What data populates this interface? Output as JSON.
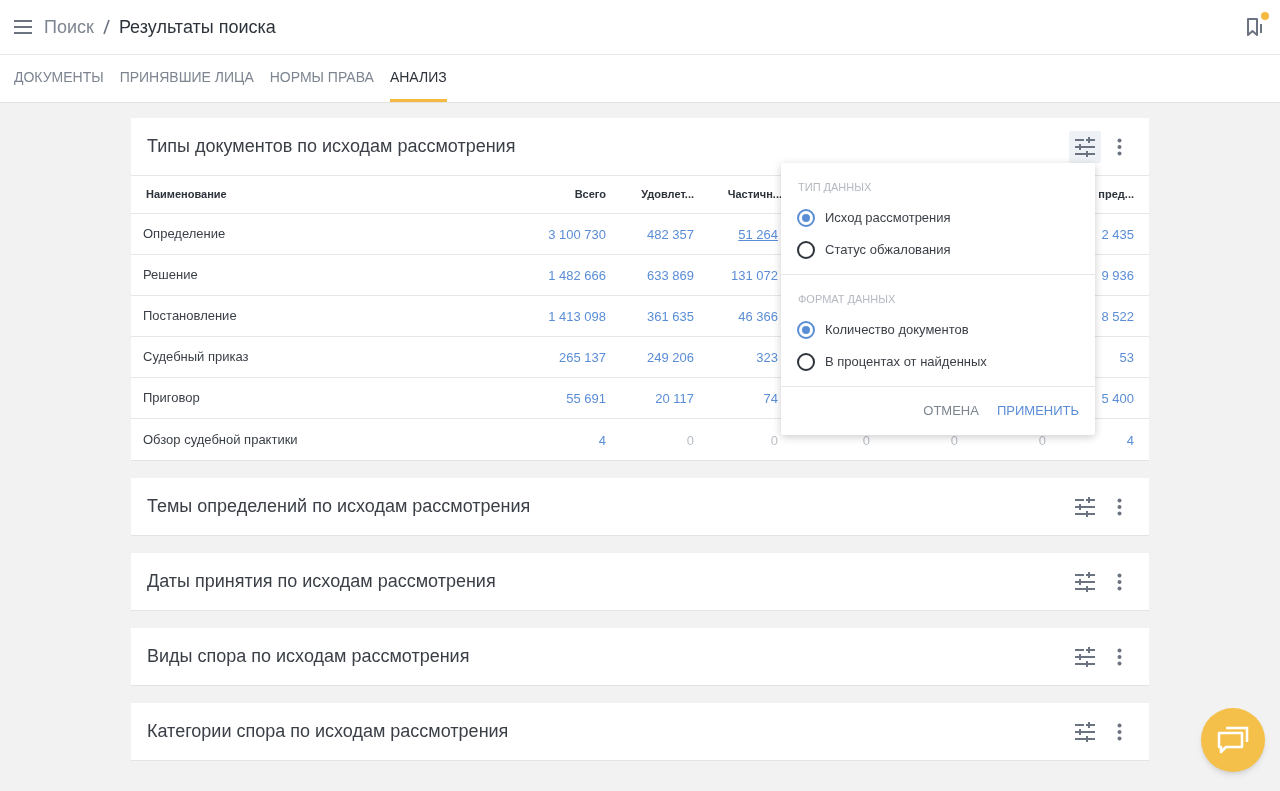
{
  "header": {
    "breadcrumbs": [
      {
        "label": "Поиск",
        "current": false
      },
      {
        "label": "Результаты поиска",
        "current": true
      }
    ],
    "bookmarks_badge": true
  },
  "tabs": [
    {
      "label": "ДОКУМЕНТЫ",
      "selected": false
    },
    {
      "label": "ПРИНЯВШИЕ ЛИЦА",
      "selected": false
    },
    {
      "label": "НОРМЫ ПРАВА",
      "selected": false
    },
    {
      "label": "АНАЛИЗ",
      "selected": true
    }
  ],
  "panels": [
    {
      "title": "Типы документов по исходам рассмотрения",
      "settings_open": true,
      "table": {
        "columns": [
          "Наименование",
          "Всего",
          "Удовлет...",
          "Частичн...",
          null,
          null,
          null,
          "пред..."
        ],
        "rows": [
          {
            "cells": [
              {
                "text": "Определение",
                "kind": "name"
              },
              {
                "text": "3 100 730",
                "kind": "link"
              },
              {
                "text": "482 357",
                "kind": "link"
              },
              {
                "text": "51 264",
                "kind": "hover"
              },
              null,
              null,
              null,
              {
                "text": "2 435",
                "kind": "link"
              }
            ]
          },
          {
            "cells": [
              {
                "text": "Решение",
                "kind": "name"
              },
              {
                "text": "1 482 666",
                "kind": "link"
              },
              {
                "text": "633 869",
                "kind": "link"
              },
              {
                "text": "131 072",
                "kind": "link"
              },
              null,
              null,
              null,
              {
                "text": "9 936",
                "kind": "link"
              }
            ]
          },
          {
            "cells": [
              {
                "text": "Постановление",
                "kind": "name"
              },
              {
                "text": "1 413 098",
                "kind": "link"
              },
              {
                "text": "361 635",
                "kind": "link"
              },
              {
                "text": "46 366",
                "kind": "link"
              },
              null,
              null,
              null,
              {
                "text": "8 522",
                "kind": "link"
              }
            ]
          },
          {
            "cells": [
              {
                "text": "Судебный приказ",
                "kind": "name"
              },
              {
                "text": "265 137",
                "kind": "link"
              },
              {
                "text": "249 206",
                "kind": "link"
              },
              {
                "text": "323",
                "kind": "link"
              },
              null,
              null,
              null,
              {
                "text": "53",
                "kind": "link"
              }
            ]
          },
          {
            "cells": [
              {
                "text": "Приговор",
                "kind": "name"
              },
              {
                "text": "55 691",
                "kind": "link"
              },
              {
                "text": "20 117",
                "kind": "link"
              },
              {
                "text": "74",
                "kind": "link"
              },
              null,
              null,
              null,
              {
                "text": "5 400",
                "kind": "link"
              }
            ]
          },
          {
            "cells": [
              {
                "text": "Обзор судебной практики",
                "kind": "name"
              },
              {
                "text": "4",
                "kind": "link"
              },
              {
                "text": "0",
                "kind": "zero"
              },
              {
                "text": "0",
                "kind": "zero"
              },
              {
                "text": "0",
                "kind": "zero"
              },
              {
                "text": "0",
                "kind": "zero"
              },
              {
                "text": "0",
                "kind": "zero"
              },
              {
                "text": "4",
                "kind": "link"
              }
            ]
          }
        ]
      }
    },
    {
      "title": "Темы определений по исходам рассмотрения",
      "settings_open": false
    },
    {
      "title": "Даты принятия по исходам рассмотрения",
      "settings_open": false
    },
    {
      "title": "Виды спора по исходам рассмотрения",
      "settings_open": false
    },
    {
      "title": "Категории спора по исходам рассмотрения",
      "settings_open": false
    }
  ],
  "popup": {
    "sections": [
      {
        "title": "ТИП ДАННЫХ",
        "options": [
          {
            "label": "Исход рассмотрения",
            "selected": true
          },
          {
            "label": "Статус обжалования",
            "selected": false
          }
        ]
      },
      {
        "title": "ФОРМАТ ДАННЫХ",
        "options": [
          {
            "label": "Количество документов",
            "selected": true
          },
          {
            "label": "В процентах от найденных",
            "selected": false
          }
        ]
      }
    ],
    "buttons": [
      {
        "label": "ОТМЕНА",
        "kind": "secondary"
      },
      {
        "label": "ПРИМЕНИТЬ",
        "kind": "primary"
      }
    ]
  }
}
